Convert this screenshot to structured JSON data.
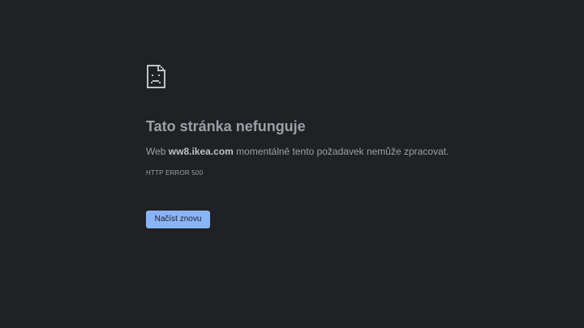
{
  "error_page": {
    "icon": "sad-page-icon",
    "title": "Tato stránka nefunguje",
    "message_prefix": "Web ",
    "domain": "ww8.ikea.com",
    "message_suffix": " momentálně tento požadavek nemůže zpracovat.",
    "error_code": "HTTP ERROR 500",
    "reload_label": "Načíst znovu"
  },
  "colors": {
    "background": "#202124",
    "text": "#9aa0a6",
    "button": "#8ab4f8"
  }
}
